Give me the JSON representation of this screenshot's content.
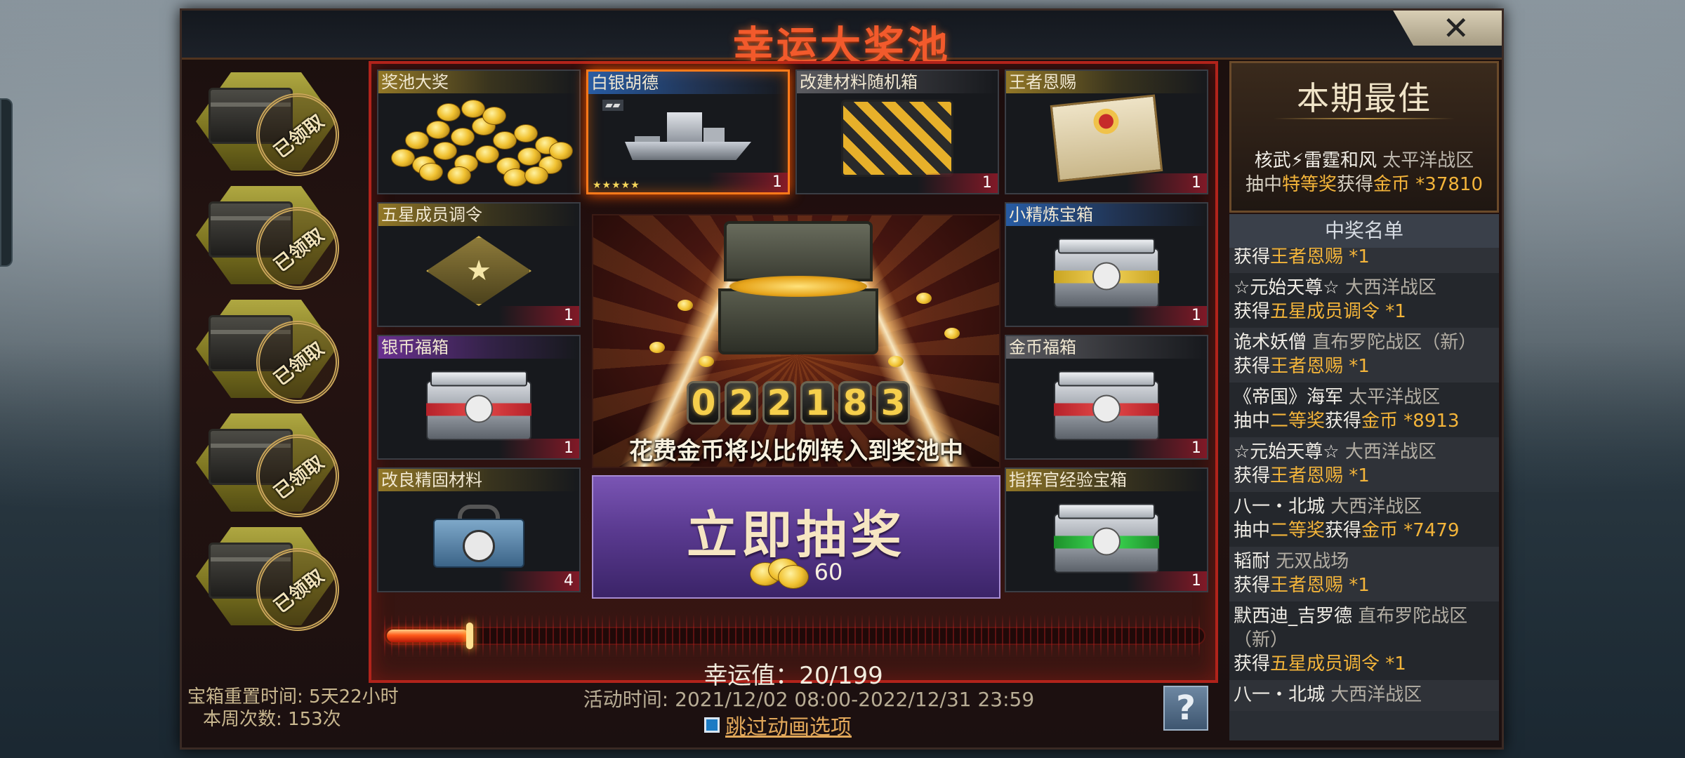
{
  "window": {
    "title": "幸运大奖池",
    "close_label": "✕"
  },
  "chests": [
    {
      "status": "已领取"
    },
    {
      "status": "已领取"
    },
    {
      "status": "已领取"
    },
    {
      "status": "已领取"
    },
    {
      "status": "已领取"
    }
  ],
  "chest_info": {
    "reset_time": "宝箱重置时间: 5天22小时",
    "weekly_count": "本周次数: 153次"
  },
  "prizes": [
    {
      "name": "奖池大奖",
      "count": ""
    },
    {
      "name": "白银胡德",
      "count": "1",
      "stars": "★★★★★"
    },
    {
      "name": "改建材料随机箱",
      "count": "1"
    },
    {
      "name": "王者恩赐",
      "count": "1"
    },
    {
      "name": "五星成员调令",
      "count": "1"
    },
    {
      "name": "小精炼宝箱",
      "count": "1"
    },
    {
      "name": "银币福箱",
      "count": "1"
    },
    {
      "name": "金币福箱",
      "count": "1"
    },
    {
      "name": "改良精固材料",
      "count": "4"
    },
    {
      "name": "指挥官经验宝箱",
      "count": "1"
    }
  ],
  "jackpot": {
    "digits": [
      "0",
      "2",
      "2",
      "1",
      "8",
      "3"
    ],
    "caption": "花费金币将以比例转入到奖池中"
  },
  "draw_button": {
    "label": "立即抽奖",
    "cost": "60"
  },
  "luck": {
    "text": "幸运值：20/199",
    "current": 20,
    "max": 199
  },
  "activity_time": "活动时间: 2021/12/02 08:00-2022/12/31 23:59",
  "skip_animation": "跳过动画选项",
  "help_label": "?",
  "best": {
    "title": "本期最佳",
    "player": "核武⚡雷霆和风",
    "region": "太平洋战区",
    "prefix": "抽中",
    "prize": "特等奖",
    "mid": "获得",
    "reward": "金币 *37810"
  },
  "winners": {
    "title": "中奖名单",
    "rows": [
      {
        "name": "",
        "region": "",
        "action": "获得",
        "prize": "王者恩赐 *1"
      },
      {
        "name": "☆元始天尊☆",
        "region": "大西洋战区",
        "action": "获得",
        "prize": "五星成员调令 *1"
      },
      {
        "name": "诡术妖僧",
        "region": "直布罗陀战区（新）",
        "action": "获得",
        "prize": "王者恩赐 *1"
      },
      {
        "name": "《帝国》海军",
        "region": "太平洋战区",
        "action": "抽中",
        "prize": "二等奖",
        "mid": "获得",
        "reward": "金币 *8913"
      },
      {
        "name": "☆元始天尊☆",
        "region": "大西洋战区",
        "action": "获得",
        "prize": "王者恩赐 *1"
      },
      {
        "name": "八一・北城",
        "region": "大西洋战区",
        "action": "抽中",
        "prize": "二等奖",
        "mid": "获得",
        "reward": "金币 *7479"
      },
      {
        "name": "韬耐",
        "region": "无双战场",
        "action": "获得",
        "prize": "王者恩赐 *1"
      },
      {
        "name": "默西迪_吉罗德",
        "region": "直布罗陀战区（新）",
        "action": "获得",
        "prize": "五星成员调令 *1"
      },
      {
        "name": "八一・北城",
        "region": "大西洋战区",
        "action": "",
        "prize": ""
      }
    ]
  },
  "colors": {
    "title": "#f25a2c",
    "accent_gold": "#f3b43a",
    "draw_button": "#5a3a90",
    "frame_red": "#b1231b"
  }
}
